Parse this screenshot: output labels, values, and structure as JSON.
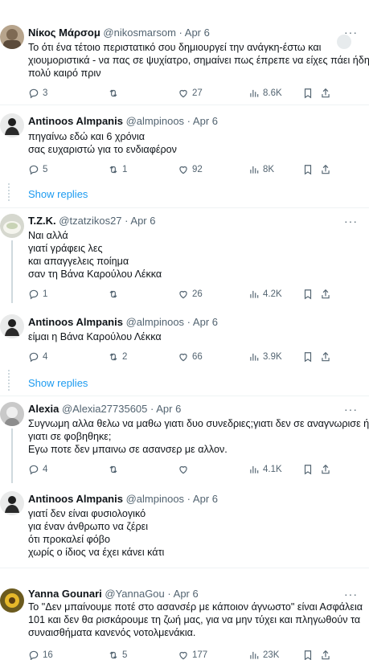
{
  "tweets": [
    {
      "name": "Νίκος Μάρσομ",
      "handle": "@nikosmarsom",
      "date": "Apr 6",
      "lines": [
        "Το ότι ένα τέτοιο περιστατικό σου δημιουργεί την ανάγκη-έστω και",
        "χιουμοριστικά - να πας σε ψυχίατρο, σημαίνει πως έπρεπε να είχες πάει ήδη",
        "πολύ καιρό πριν"
      ],
      "stats": {
        "replies": "3",
        "reposts": "",
        "likes": "27",
        "views": "8.6K"
      }
    },
    {
      "name": "Antinoos Almpanis",
      "handle": "@almpinoos",
      "date": "Apr 6",
      "lines": [
        "πηγαίνω εδώ και 6 χρόνια",
        "σας ευχαριστώ για το ενδιαφέρον"
      ],
      "stats": {
        "replies": "5",
        "reposts": "1",
        "likes": "92",
        "views": "8K"
      }
    },
    {
      "name": "T.Z.K.",
      "handle": "@tzatzikos27",
      "date": "Apr 6",
      "lines": [
        "Ναι αλλά",
        "γιατί γράφεις λες",
        "και απαγγελεις ποίημα",
        "σαν τη Βάνα Καρούλου Λέκκα"
      ],
      "stats": {
        "replies": "1",
        "reposts": "",
        "likes": "26",
        "views": "4.2K"
      }
    },
    {
      "name": "Antinoos Almpanis",
      "handle": "@almpinoos",
      "date": "Apr 6",
      "lines": [
        "είμαι η Βάνα Καρούλου Λέκκα"
      ],
      "stats": {
        "replies": "4",
        "reposts": "2",
        "likes": "66",
        "views": "3.9K"
      }
    },
    {
      "name": "Alexia",
      "handle": "@Alexia27735605",
      "date": "Apr 6",
      "lines": [
        "Συγνωμη αλλα θελω να μαθω γιατι δυο συνεδριες;γιατι δεν σε αναγνωρισε ή",
        "γιατι σε φοβηθηκε;",
        "Εγω ποτε δεν μπαινω σε ασανσερ με αλλον."
      ],
      "stats": {
        "replies": "4",
        "reposts": "",
        "likes": "",
        "views": "4.1K"
      }
    },
    {
      "name": "Antinoos Almpanis",
      "handle": "@almpinoos",
      "date": "Apr 6",
      "lines": [
        "γιατί δεν είναι φυσιολογικό",
        "για έναν άνθρωπο να ζέρει",
        "ότι προκαλεί φόβο",
        "χωρίς ο ίδιος να έχει κάνει κάτι"
      ],
      "stats": {
        "replies": "",
        "reposts": "",
        "likes": "",
        "views": ""
      }
    },
    {
      "name": "Yanna Gounari",
      "handle": "@YannaGou",
      "date": "Apr 6",
      "lines": [
        "Το \"Δεν μπαίνουμε ποτέ στο ασανσέρ με κάποιον άγνωστο\" είναι Ασφάλεια",
        "101 και δεν θα ρισκάρουμε τη ζωή μας, για να μην τύχει και πληγωθούν τα",
        "συναισθήματα κανενός νοτολμενάκια."
      ],
      "stats": {
        "replies": "16",
        "reposts": "5",
        "likes": "177",
        "views": "23K"
      }
    }
  ],
  "show_replies": [
    "Show replies",
    "Show replies"
  ],
  "more_label": "···",
  "separator": "·"
}
